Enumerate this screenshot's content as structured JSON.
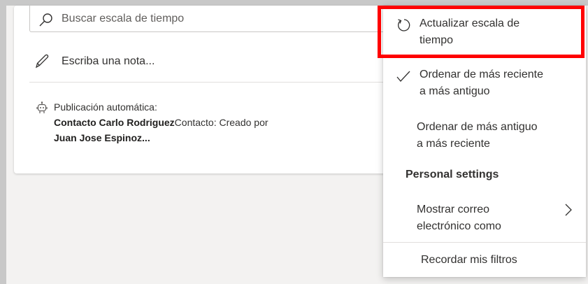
{
  "search": {
    "placeholder": "Buscar escala de tiempo",
    "icon": "search-icon"
  },
  "note": {
    "placeholder": "Escriba una nota...",
    "icon": "pencil-icon"
  },
  "post": {
    "header": "Publicación automática:",
    "contact_bold": "Contacto Carlo Rodriguez",
    "contact_text": "Contacto: Creado por",
    "author_bold": "Juan Jose Espinoz..."
  },
  "menu": {
    "refresh": {
      "line1": "Actualizar escala de",
      "line2": "tiempo",
      "icon": "refresh-icon"
    },
    "sort_newest": {
      "line1": "Ordenar de más reciente",
      "line2": "a más antiguo",
      "checked": true,
      "icon": "check-icon"
    },
    "sort_oldest": {
      "line1": "Ordenar de más antiguo",
      "line2": "a más reciente"
    },
    "personal_heading": "Personal settings",
    "email_display": {
      "line1": "Mostrar correo",
      "line2": "electrónico como",
      "icon": "chevron-right-icon"
    },
    "remember_filters": "Recordar mis filtros"
  },
  "colors": {
    "highlight": "#ff0000",
    "canvas": "#f3f2f1"
  }
}
